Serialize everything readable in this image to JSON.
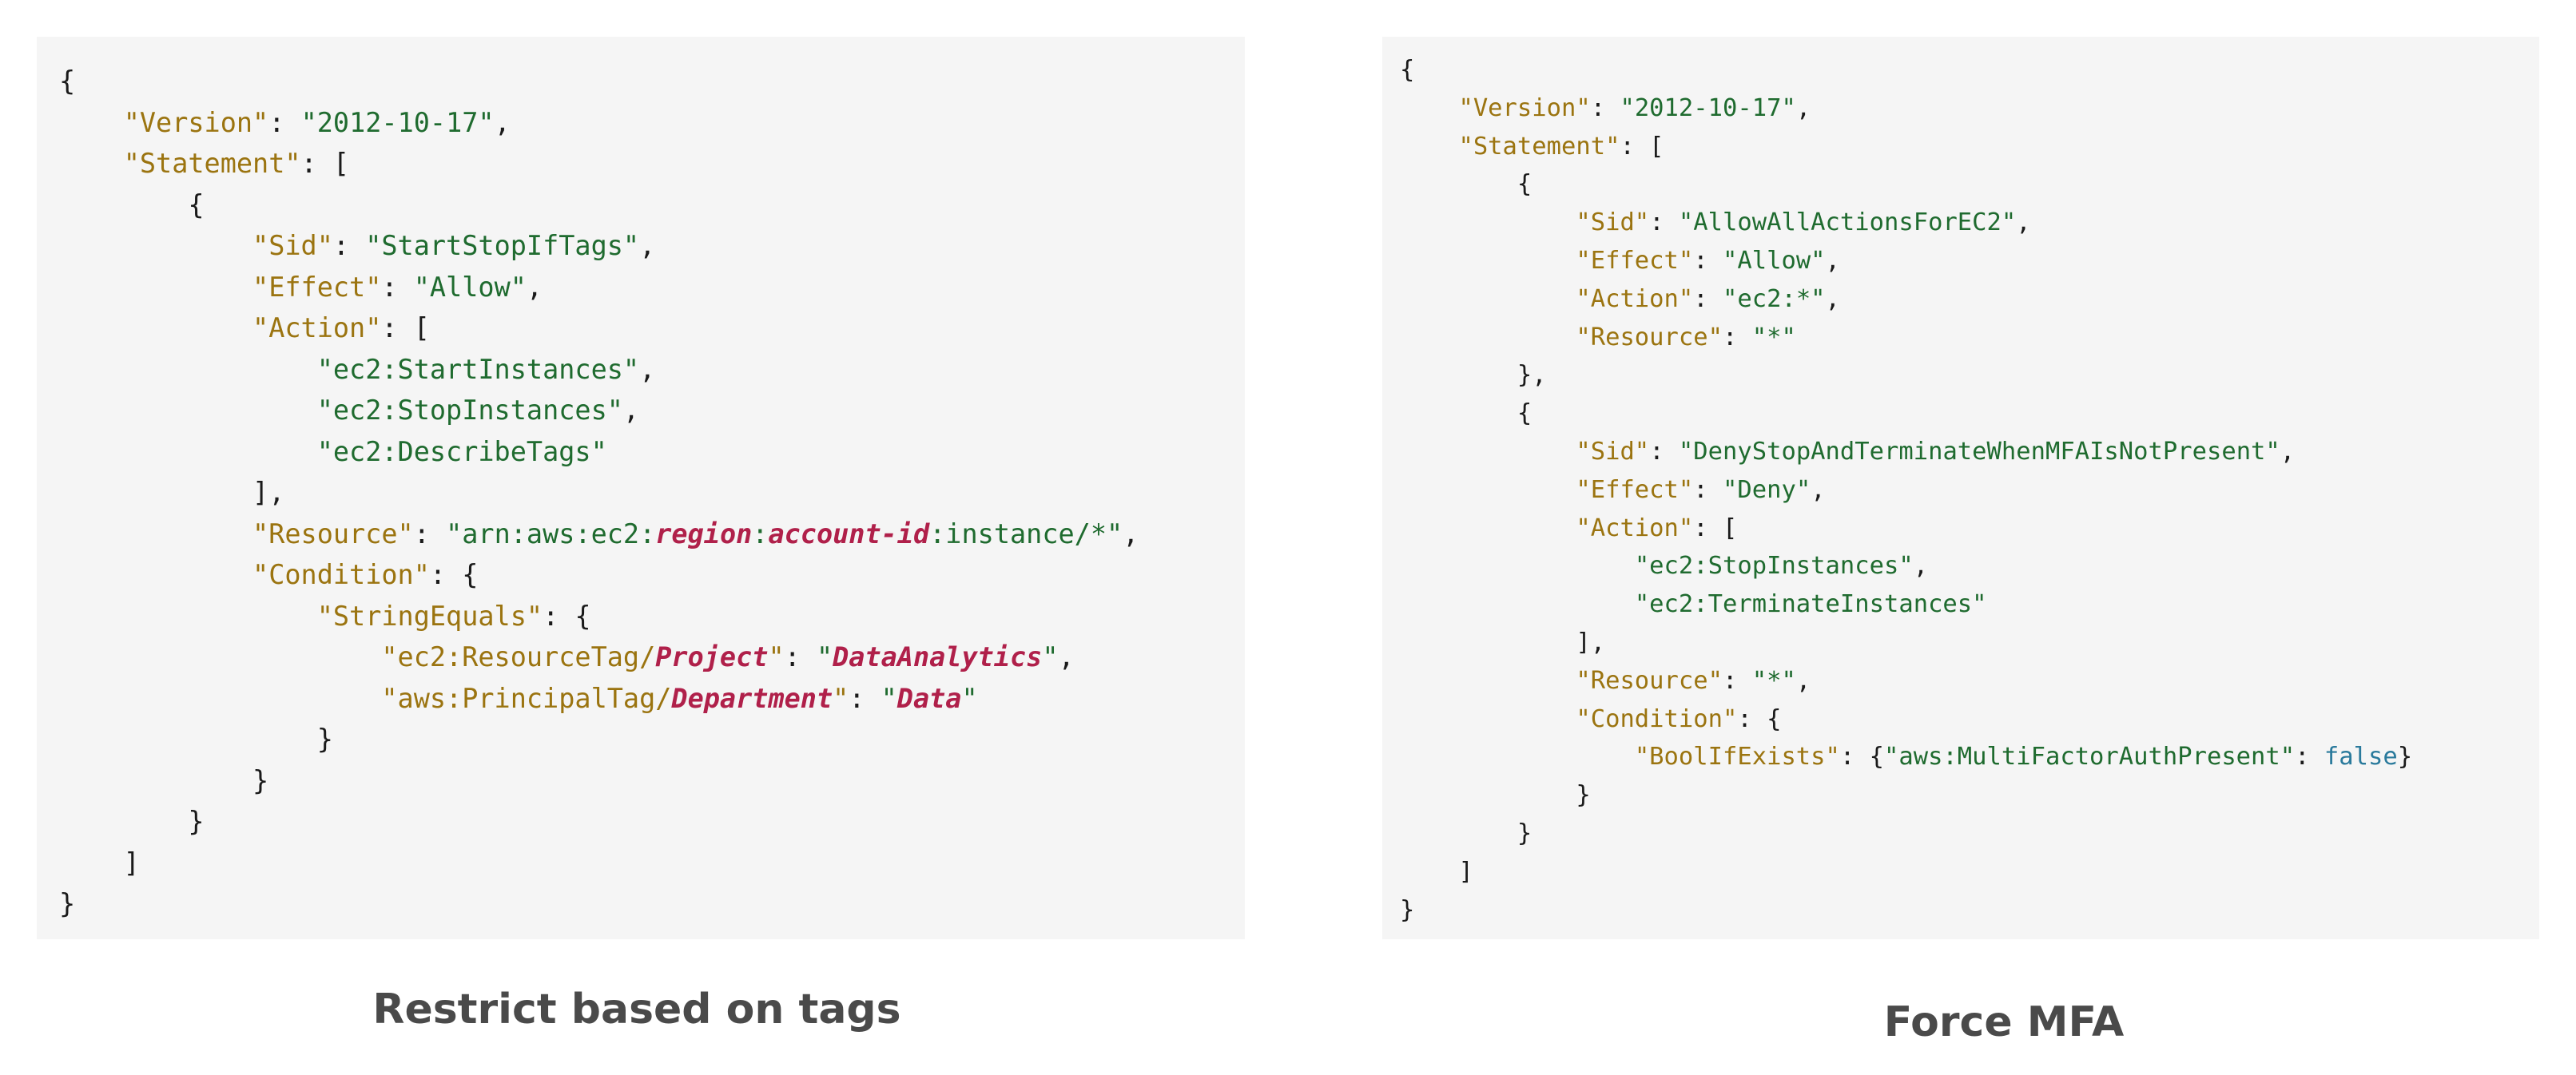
{
  "left_policy": {
    "caption": "Restrict based on tags",
    "lines": [
      [
        {
          "t": "{"
        }
      ],
      [
        {
          "t": "    "
        },
        {
          "c": "k",
          "t": "\"Version\""
        },
        {
          "t": ": "
        },
        {
          "c": "s",
          "t": "\"2012-10-17\""
        },
        {
          "t": ","
        }
      ],
      [
        {
          "t": "    "
        },
        {
          "c": "k",
          "t": "\"Statement\""
        },
        {
          "t": ": ["
        }
      ],
      [
        {
          "t": "        {"
        }
      ],
      [
        {
          "t": "            "
        },
        {
          "c": "k",
          "t": "\"Sid\""
        },
        {
          "t": ": "
        },
        {
          "c": "s",
          "t": "\"StartStopIfTags\""
        },
        {
          "t": ","
        }
      ],
      [
        {
          "t": "            "
        },
        {
          "c": "k",
          "t": "\"Effect\""
        },
        {
          "t": ": "
        },
        {
          "c": "s",
          "t": "\"Allow\""
        },
        {
          "t": ","
        }
      ],
      [
        {
          "t": "            "
        },
        {
          "c": "k",
          "t": "\"Action\""
        },
        {
          "t": ": ["
        }
      ],
      [
        {
          "t": "                "
        },
        {
          "c": "s",
          "t": "\"ec2:StartInstances\""
        },
        {
          "t": ","
        }
      ],
      [
        {
          "t": "                "
        },
        {
          "c": "s",
          "t": "\"ec2:StopInstances\""
        },
        {
          "t": ","
        }
      ],
      [
        {
          "t": "                "
        },
        {
          "c": "s",
          "t": "\"ec2:DescribeTags\""
        }
      ],
      [
        {
          "t": "            ],"
        }
      ],
      [
        {
          "t": "            "
        },
        {
          "c": "k",
          "t": "\"Resource\""
        },
        {
          "t": ": "
        },
        {
          "c": "s",
          "t": "\"arn:aws:ec2:"
        },
        {
          "c": "v",
          "t": "region"
        },
        {
          "c": "s",
          "t": ":"
        },
        {
          "c": "v",
          "t": "account-id"
        },
        {
          "c": "s",
          "t": ":instance/*\""
        },
        {
          "t": ","
        }
      ],
      [
        {
          "t": "            "
        },
        {
          "c": "k",
          "t": "\"Condition\""
        },
        {
          "t": ": {"
        }
      ],
      [
        {
          "t": "                "
        },
        {
          "c": "k",
          "t": "\"StringEquals\""
        },
        {
          "t": ": {"
        }
      ],
      [
        {
          "t": "                    "
        },
        {
          "c": "k",
          "t": "\"ec2:ResourceTag/"
        },
        {
          "c": "v",
          "t": "Project"
        },
        {
          "c": "k",
          "t": "\""
        },
        {
          "t": ": "
        },
        {
          "c": "s",
          "t": "\""
        },
        {
          "c": "v",
          "t": "DataAnalytics"
        },
        {
          "c": "s",
          "t": "\""
        },
        {
          "t": ","
        }
      ],
      [
        {
          "t": "                    "
        },
        {
          "c": "k",
          "t": "\"aws:PrincipalTag/"
        },
        {
          "c": "v",
          "t": "Department"
        },
        {
          "c": "k",
          "t": "\""
        },
        {
          "t": ": "
        },
        {
          "c": "s",
          "t": "\""
        },
        {
          "c": "v",
          "t": "Data"
        },
        {
          "c": "s",
          "t": "\""
        }
      ],
      [
        {
          "t": "                }"
        }
      ],
      [
        {
          "t": "            }"
        }
      ],
      [
        {
          "t": "        }"
        }
      ],
      [
        {
          "t": "    ]"
        }
      ],
      [
        {
          "t": "}"
        }
      ]
    ]
  },
  "right_policy": {
    "caption": "Force MFA",
    "lines": [
      [
        {
          "t": "{"
        }
      ],
      [
        {
          "t": "    "
        },
        {
          "c": "k",
          "t": "\"Version\""
        },
        {
          "t": ": "
        },
        {
          "c": "s",
          "t": "\"2012-10-17\""
        },
        {
          "t": ","
        }
      ],
      [
        {
          "t": "    "
        },
        {
          "c": "k",
          "t": "\"Statement\""
        },
        {
          "t": ": ["
        }
      ],
      [
        {
          "t": "        {"
        }
      ],
      [
        {
          "t": "            "
        },
        {
          "c": "k",
          "t": "\"Sid\""
        },
        {
          "t": ": "
        },
        {
          "c": "s",
          "t": "\"AllowAllActionsForEC2\""
        },
        {
          "t": ","
        }
      ],
      [
        {
          "t": "            "
        },
        {
          "c": "k",
          "t": "\"Effect\""
        },
        {
          "t": ": "
        },
        {
          "c": "s",
          "t": "\"Allow\""
        },
        {
          "t": ","
        }
      ],
      [
        {
          "t": "            "
        },
        {
          "c": "k",
          "t": "\"Action\""
        },
        {
          "t": ": "
        },
        {
          "c": "s",
          "t": "\"ec2:*\""
        },
        {
          "t": ","
        }
      ],
      [
        {
          "t": "            "
        },
        {
          "c": "k",
          "t": "\"Resource\""
        },
        {
          "t": ": "
        },
        {
          "c": "s",
          "t": "\"*\""
        }
      ],
      [
        {
          "t": "        },"
        }
      ],
      [
        {
          "t": "        {"
        }
      ],
      [
        {
          "t": "            "
        },
        {
          "c": "k",
          "t": "\"Sid\""
        },
        {
          "t": ": "
        },
        {
          "c": "s",
          "t": "\"DenyStopAndTerminateWhenMFAIsNotPresent\""
        },
        {
          "t": ","
        }
      ],
      [
        {
          "t": "            "
        },
        {
          "c": "k",
          "t": "\"Effect\""
        },
        {
          "t": ": "
        },
        {
          "c": "s",
          "t": "\"Deny\""
        },
        {
          "t": ","
        }
      ],
      [
        {
          "t": "            "
        },
        {
          "c": "k",
          "t": "\"Action\""
        },
        {
          "t": ": ["
        }
      ],
      [
        {
          "t": "                "
        },
        {
          "c": "s",
          "t": "\"ec2:StopInstances\""
        },
        {
          "t": ","
        }
      ],
      [
        {
          "t": "                "
        },
        {
          "c": "s",
          "t": "\"ec2:TerminateInstances\""
        }
      ],
      [
        {
          "t": "            ],"
        }
      ],
      [
        {
          "t": "            "
        },
        {
          "c": "k",
          "t": "\"Resource\""
        },
        {
          "t": ": "
        },
        {
          "c": "s",
          "t": "\"*\""
        },
        {
          "t": ","
        }
      ],
      [
        {
          "t": "            "
        },
        {
          "c": "k",
          "t": "\"Condition\""
        },
        {
          "t": ": {"
        }
      ],
      [
        {
          "t": "                "
        },
        {
          "c": "k",
          "t": "\"BoolIfExists\""
        },
        {
          "t": ": {"
        },
        {
          "c": "s",
          "t": "\"aws:MultiFactorAuthPresent\""
        },
        {
          "t": ": "
        },
        {
          "c": "b",
          "t": "false"
        },
        {
          "t": "}"
        }
      ],
      [
        {
          "t": "            }"
        }
      ],
      [
        {
          "t": "        }"
        }
      ],
      [
        {
          "t": "    ]"
        }
      ],
      [
        {
          "t": "}"
        }
      ]
    ]
  }
}
